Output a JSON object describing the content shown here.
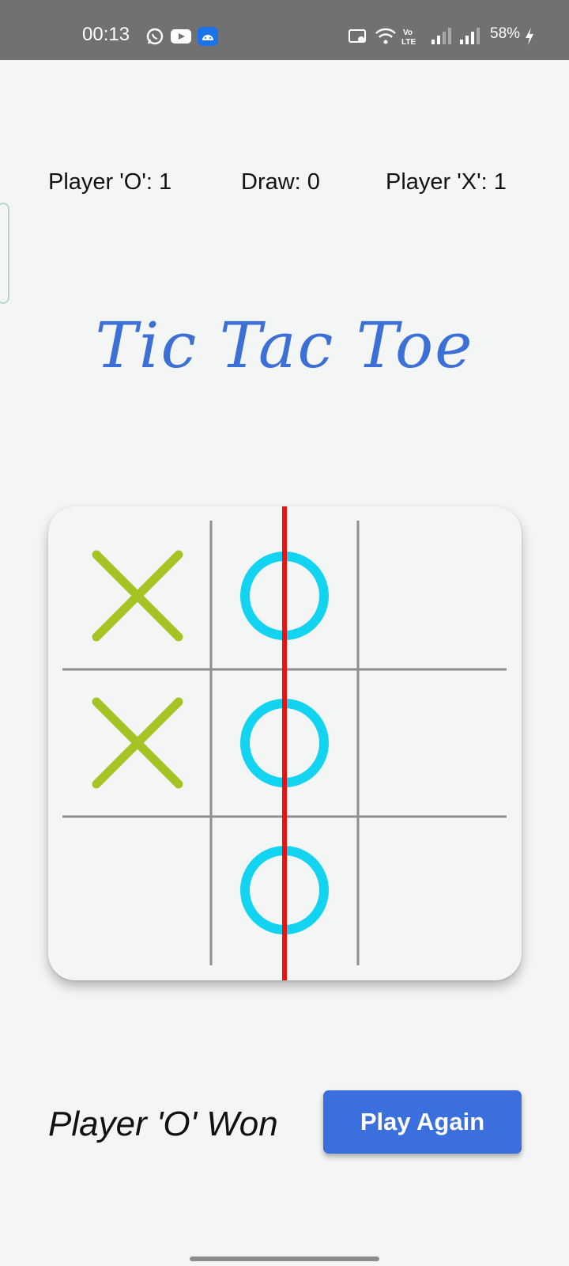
{
  "status_bar": {
    "time": "00:13",
    "battery": "58%",
    "icons": [
      "whatsapp-icon",
      "youtube-icon",
      "android-icon",
      "cast-icon",
      "wifi-icon",
      "volte-icon",
      "signal-icon",
      "signal-icon",
      "charging-icon"
    ]
  },
  "scoreboard": {
    "player_o": "Player 'O': 1",
    "draw": "Draw: 0",
    "player_x": "Player 'X': 1"
  },
  "title": "Tic Tac Toe",
  "board": {
    "cells": [
      "X",
      "O",
      "",
      "X",
      "O",
      "",
      "",
      "O",
      ""
    ],
    "winning_line": "middle-column",
    "colors": {
      "x": "#a6c325",
      "o": "#12d3f0",
      "grid": "#8e8e8e",
      "win": "#ee1111"
    }
  },
  "result": "Player 'O' Won",
  "play_again_label": "Play Again",
  "colors": {
    "accent": "#3b6fdd",
    "title": "#3c70d6",
    "status_bar": "#717171"
  }
}
